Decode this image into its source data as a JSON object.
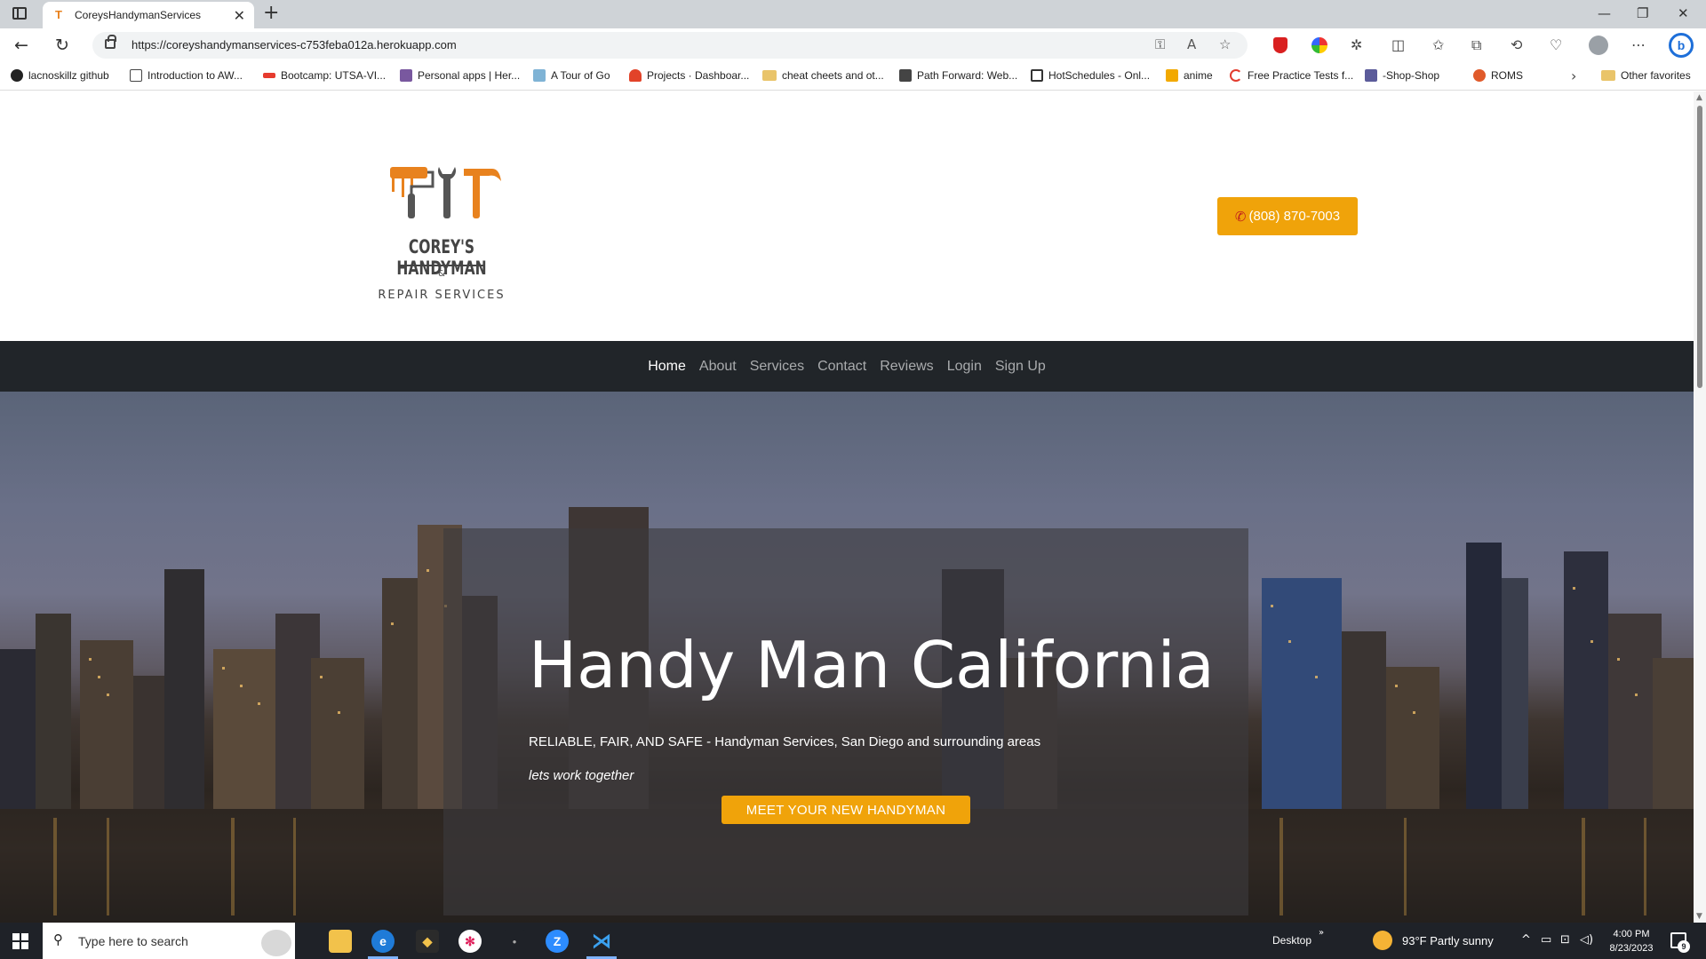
{
  "browser": {
    "tab_title": "CoreysHandymanServices",
    "tab_favicon": "T",
    "url": "https://coreyshandymanservices-c753feba012a.herokuapp.com",
    "bookmarks": [
      {
        "label": "lacnoskillz github",
        "icon": "github-icon",
        "color": "#222222"
      },
      {
        "label": "Introduction to AW...",
        "icon": "page-icon",
        "color": "#ffffff"
      },
      {
        "label": "Bootcamp: UTSA-VI...",
        "icon": "usa-icon",
        "color": "#e63b2e"
      },
      {
        "label": "Personal apps | Her...",
        "icon": "heroku-icon",
        "color": "#79589f"
      },
      {
        "label": "A Tour of Go",
        "icon": "go-icon",
        "color": "#7fb3d5"
      },
      {
        "label": "Projects · Dashboar...",
        "icon": "gitlab-icon",
        "color": "#e24329"
      },
      {
        "label": "cheat cheets and ot...",
        "icon": "folder-icon",
        "color": "#e9c46a"
      },
      {
        "label": "Path Forward: Web...",
        "icon": "pathforward-icon",
        "color": "#444444"
      },
      {
        "label": "HotSchedules - Onl...",
        "icon": "hotschedules-icon",
        "color": "#333333"
      },
      {
        "label": "anime",
        "icon": "anime-icon",
        "color": "#f2a900"
      },
      {
        "label": "Free Practice Tests f...",
        "icon": "practice-test-icon",
        "color": "#e23b2e"
      },
      {
        "label": "-Shop-Shop",
        "icon": "shop-icon",
        "color": "#5b5b9a"
      },
      {
        "label": "ROMS",
        "icon": "roms-icon",
        "color": "#e05a2a"
      }
    ],
    "other_favorites": "Other favorites"
  },
  "header": {
    "logo": {
      "title": "COREY'S HANDYMAN",
      "amp": "&",
      "subtitle": "REPAIR SERVICES"
    },
    "phone": "(808) 870-7003"
  },
  "nav": {
    "items": [
      {
        "label": "Home",
        "active": true
      },
      {
        "label": "About",
        "active": false
      },
      {
        "label": "Services",
        "active": false
      },
      {
        "label": "Contact",
        "active": false
      },
      {
        "label": "Reviews",
        "active": false
      },
      {
        "label": "Login",
        "active": false
      },
      {
        "label": "Sign Up",
        "active": false
      }
    ]
  },
  "hero": {
    "title": "Handy Man California",
    "tagline": "RELIABLE, FAIR, AND SAFE - Handyman Services, San Diego and surrounding areas",
    "subtitle": "lets work together",
    "cta": "MEET YOUR NEW HANDYMAN"
  },
  "taskbar": {
    "search_placeholder": "Type here to search",
    "desktop_label": "Desktop",
    "weather": "93°F  Partly sunny",
    "time": "4:00 PM",
    "date": "8/23/2023",
    "notification_count": "9"
  },
  "colors": {
    "accent": "#f0a30a",
    "navbar": "#212529",
    "phone_icon": "#c0201d"
  }
}
